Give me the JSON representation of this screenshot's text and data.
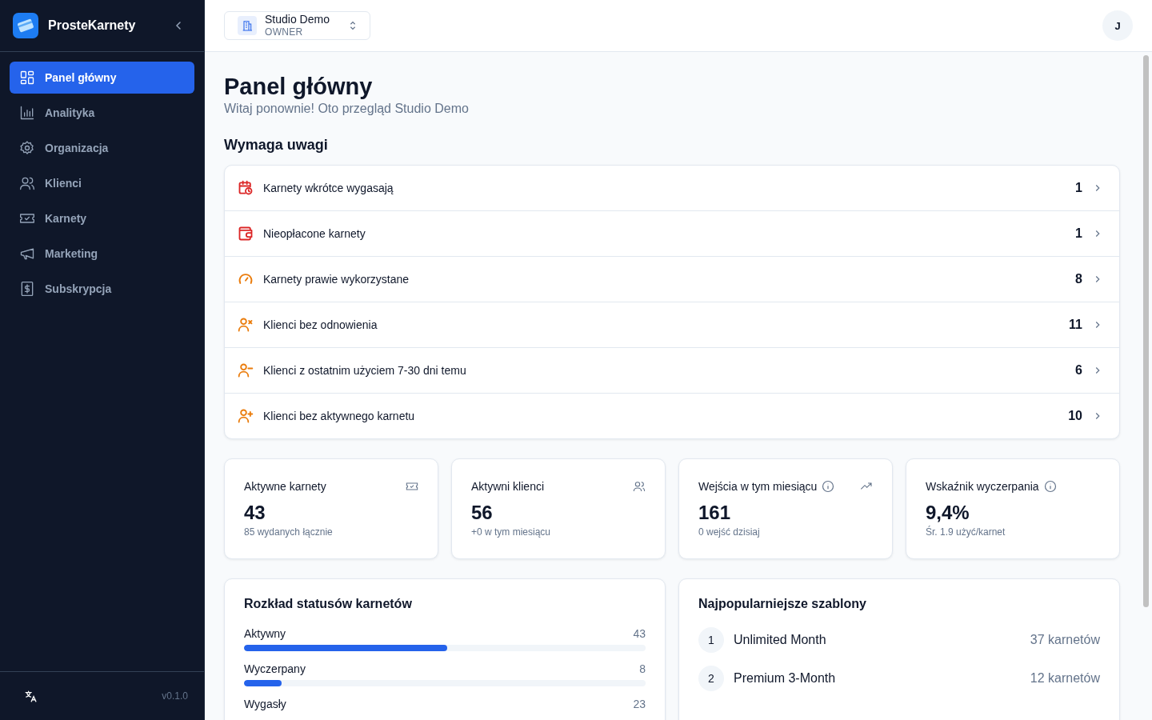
{
  "sidebar": {
    "brand": "ProsteKarnety",
    "items": [
      {
        "label": "Panel główny",
        "kind": "dashboard",
        "selected": true
      },
      {
        "label": "Analityka",
        "kind": "chart",
        "selected": false
      },
      {
        "label": "Organizacja",
        "kind": "gear",
        "selected": false
      },
      {
        "label": "Klienci",
        "kind": "users",
        "selected": false
      },
      {
        "label": "Karnety",
        "kind": "ticket",
        "selected": false
      },
      {
        "label": "Marketing",
        "kind": "megaphone",
        "selected": false
      },
      {
        "label": "Subskrypcja",
        "kind": "dollar",
        "selected": false
      }
    ],
    "version": "v0.1.0"
  },
  "header": {
    "workspace": {
      "name": "Studio Demo",
      "role": "OWNER"
    },
    "avatar": "J"
  },
  "page": {
    "title": "Panel główny",
    "subtitle": "Witaj ponownie! Oto przegląd Studio Demo"
  },
  "attention": {
    "title": "Wymaga uwagi",
    "items": [
      {
        "label": "Karnety wkrótce wygasają",
        "count": "1",
        "kind": "calendar",
        "color": "#dc2626"
      },
      {
        "label": "Nieopłacone karnety",
        "count": "1",
        "kind": "wallet",
        "color": "#dc2626"
      },
      {
        "label": "Karnety prawie wykorzystane",
        "count": "8",
        "kind": "gauge",
        "color": "#ea7c0c"
      },
      {
        "label": "Klienci bez odnowienia",
        "count": "11",
        "kind": "userx",
        "color": "#ea7c0c"
      },
      {
        "label": "Klienci z ostatnim użyciem 7-30 dni temu",
        "count": "6",
        "kind": "userminus",
        "color": "#ea7c0c"
      },
      {
        "label": "Klienci bez aktywnego karnetu",
        "count": "10",
        "kind": "userplus",
        "color": "#ea7c0c"
      }
    ]
  },
  "stats": [
    {
      "label": "Aktywne karnety",
      "value": "43",
      "note": "85 wydanych łącznie",
      "kind": "ticket",
      "info": false
    },
    {
      "label": "Aktywni klienci",
      "value": "56",
      "note": "+0 w tym miesiącu",
      "kind": "users",
      "info": false
    },
    {
      "label": "Wejścia w tym miesiącu",
      "value": "161",
      "note": "0 wejść dzisiaj",
      "kind": "trend",
      "info": true
    },
    {
      "label": "Wskaźnik wyczerpania",
      "value": "9,4%",
      "note": "Śr. 1.9 użyć/karnet",
      "kind": "none",
      "info": true
    }
  ],
  "status_breakdown": {
    "title": "Rozkład statusów karnetów",
    "rows": [
      {
        "label": "Aktywny",
        "value": "43",
        "level": 0.505
      },
      {
        "label": "Wyczerpany",
        "value": "8",
        "level": 0.093
      },
      {
        "label": "Wygasły",
        "value": "23"
      }
    ]
  },
  "templates": {
    "title": "Najpopularniejsze szablony",
    "rows": [
      {
        "rank": "1",
        "name": "Unlimited Month",
        "count": "37 karnetów"
      },
      {
        "rank": "2",
        "name": "Premium 3-Month",
        "count": "12 karnetów"
      }
    ]
  }
}
